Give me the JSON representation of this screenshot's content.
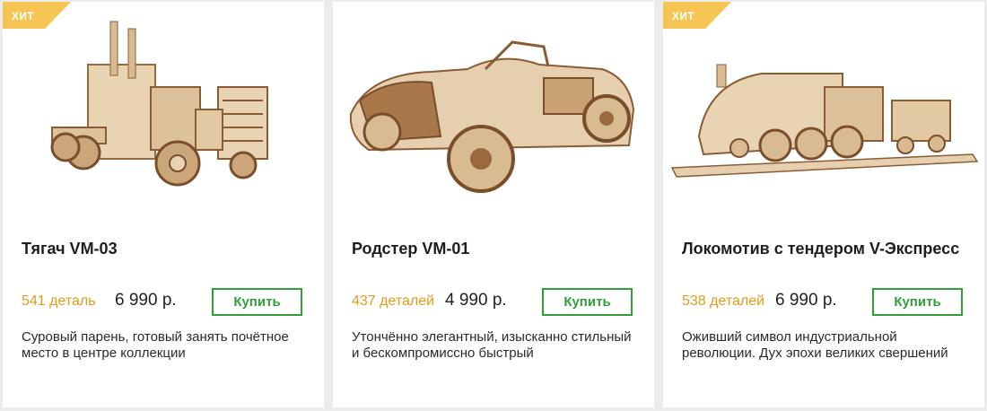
{
  "colors": {
    "badge": "#f6c453",
    "parts_text": "#e39b17",
    "buy_button": "#2f9e3b",
    "wood_light": "#e6cfae",
    "wood_dark": "#9a6a3e"
  },
  "products": [
    {
      "badge": "ХИТ",
      "image_icon": "truck-model-image",
      "title": "Тягач VM-03",
      "parts": "541 деталь",
      "price": "6 990 р.",
      "buy_label": "Купить",
      "description": "Суровый парень, готовый занять почётное место в центре коллекции"
    },
    {
      "badge": "",
      "image_icon": "roadster-model-image",
      "title": "Родстер VM-01",
      "parts": "437 деталей",
      "price": "4 990 р.",
      "buy_label": "Купить",
      "description": "Утончённо элегантный, изысканно стильный и бескомпромиссно быстрый"
    },
    {
      "badge": "ХИТ",
      "image_icon": "locomotive-model-image",
      "title": "Локомотив с тендером V-Экспресс",
      "parts": "538 деталей",
      "price": "6 990 р.",
      "buy_label": "Купить",
      "description": "Оживший символ индустриальной революции. Дух эпохи великих свершений"
    }
  ]
}
